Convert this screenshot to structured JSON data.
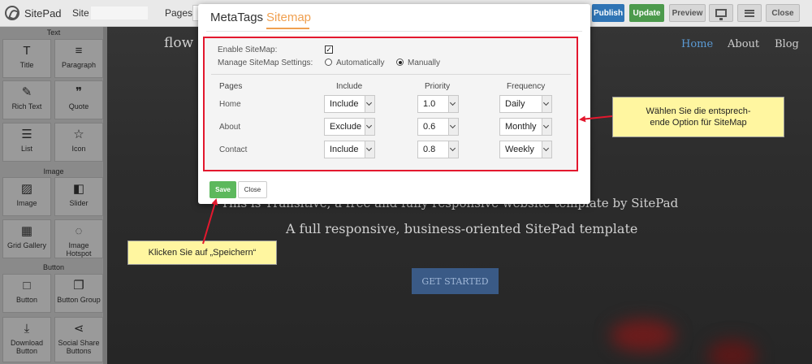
{
  "topbar": {
    "brand": "SitePad",
    "site_label": "Site :",
    "pages_label": "Pages :",
    "publish": "Publish",
    "update": "Update",
    "preview": "Preview",
    "close": "Close"
  },
  "sidebar": {
    "sections": {
      "text": "Text",
      "image": "Image",
      "button": "Button"
    },
    "widgets": [
      {
        "label": "Title",
        "icon": "T"
      },
      {
        "label": "Paragraph",
        "icon": "≡"
      },
      {
        "label": "Rich Text",
        "icon": "✎"
      },
      {
        "label": "Quote",
        "icon": "❞"
      },
      {
        "label": "List",
        "icon": "☰"
      },
      {
        "label": "Icon",
        "icon": "☆"
      },
      {
        "label": "Image",
        "icon": "▨"
      },
      {
        "label": "Slider",
        "icon": "◧"
      },
      {
        "label": "Grid Gallery",
        "icon": "▦"
      },
      {
        "label": "Image Hotspot",
        "icon": "◌"
      },
      {
        "label": "Button",
        "icon": "□"
      },
      {
        "label": "Button Group",
        "icon": "❐"
      },
      {
        "label": "Download Button",
        "icon": "⤓"
      },
      {
        "label": "Social Share Buttons",
        "icon": "⋖"
      }
    ]
  },
  "site": {
    "logo": "flow",
    "nav": [
      "Home",
      "About",
      "Blog"
    ],
    "hero_line1": "This is Transitive, a free and fully responsive website template by SitePad",
    "hero_line2": "A full responsive, business-oriented SitePad template",
    "cta": "GET STARTED"
  },
  "modal": {
    "tabs": [
      "MetaTags",
      "Sitemap"
    ],
    "active_tab": "Sitemap",
    "enable_label": "Enable SiteMap:",
    "enable_checked": true,
    "manage_label": "Manage SiteMap Settings:",
    "radio_auto": "Automatically",
    "radio_manual": "Manually",
    "radio_selected": "Manually",
    "headers": {
      "pages": "Pages",
      "include": "Include",
      "priority": "Priority",
      "frequency": "Frequency"
    },
    "rows": [
      {
        "page": "Home",
        "include": "Include",
        "priority": "1.0",
        "frequency": "Daily"
      },
      {
        "page": "About",
        "include": "Exclude",
        "priority": "0.6",
        "frequency": "Monthly"
      },
      {
        "page": "Contact",
        "include": "Include",
        "priority": "0.8",
        "frequency": "Weekly"
      }
    ],
    "save": "Save",
    "close": "Close"
  },
  "callouts": {
    "right_line1": "Wählen Sie die entsprech-",
    "right_line2": "ende Option für SiteMap",
    "left": "Klicken Sie auf „Speichern“"
  },
  "colors": {
    "accent_tab": "#f0a050",
    "highlight": "#e3182e",
    "callout_bg": "#fff6a0",
    "save_green": "#5cb85c"
  }
}
